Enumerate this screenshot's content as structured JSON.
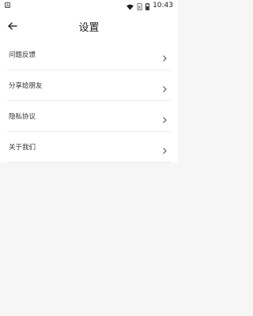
{
  "status_bar": {
    "app_icon": "A",
    "time": "10:43",
    "icons": [
      "wifi-icon",
      "no-sim-icon",
      "battery-icon"
    ]
  },
  "header": {
    "title": "设置",
    "back_icon": "arrow-left-icon"
  },
  "menu": {
    "items": [
      {
        "label": "问题反馈"
      },
      {
        "label": "分享给朋友"
      },
      {
        "label": "隐私协议"
      },
      {
        "label": "关于我们"
      }
    ]
  },
  "colors": {
    "background": "#f6f6f6",
    "surface": "#ffffff",
    "text": "#333333",
    "divider": "#ececec"
  }
}
